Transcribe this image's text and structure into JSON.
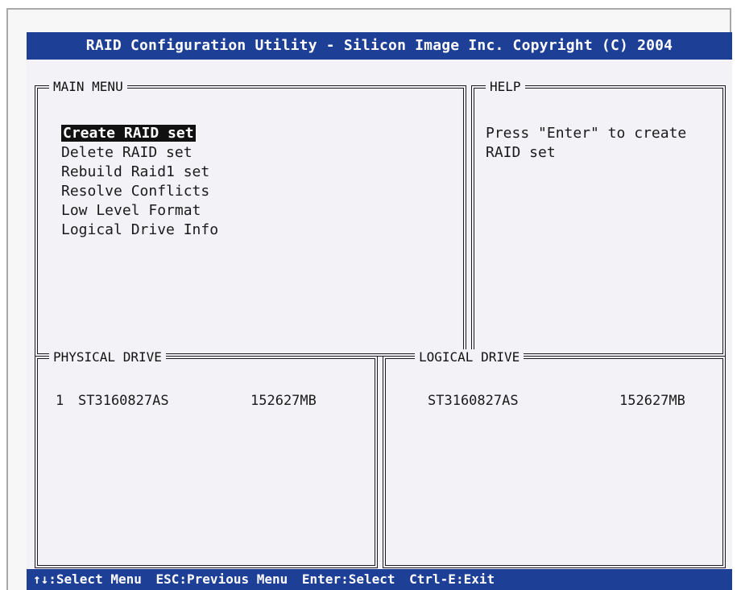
{
  "header": {
    "title": "RAID Configuration Utility - Silicon Image Inc. Copyright (C) 2004"
  },
  "main_menu": {
    "title": "MAIN MENU",
    "items": [
      {
        "label": "Create RAID set",
        "selected": true
      },
      {
        "label": "Delete RAID set"
      },
      {
        "label": "Rebuild Raid1 set"
      },
      {
        "label": "Resolve Conflicts"
      },
      {
        "label": "Low Level Format"
      },
      {
        "label": "Logical Drive Info"
      }
    ]
  },
  "help": {
    "title": "HELP",
    "text": "Press \"Enter\" to create RAID set"
  },
  "physical_drive": {
    "title": "PHYSICAL DRIVE",
    "drives": [
      {
        "index": "1",
        "model": "ST3160827AS",
        "size": "152627MB"
      }
    ]
  },
  "logical_drive": {
    "title": "LOGICAL DRIVE",
    "drives": [
      {
        "model": "ST3160827AS",
        "size": "152627MB"
      }
    ]
  },
  "status_bar": {
    "select_menu": "↑↓:Select Menu",
    "previous_menu": "ESC:Previous Menu",
    "enter_select": "Enter:Select",
    "exit": "Ctrl-E:Exit"
  },
  "colors": {
    "bar_blue": "#1e3f96",
    "screen_bg": "#f3f2f6",
    "selection_bg": "#111111"
  }
}
